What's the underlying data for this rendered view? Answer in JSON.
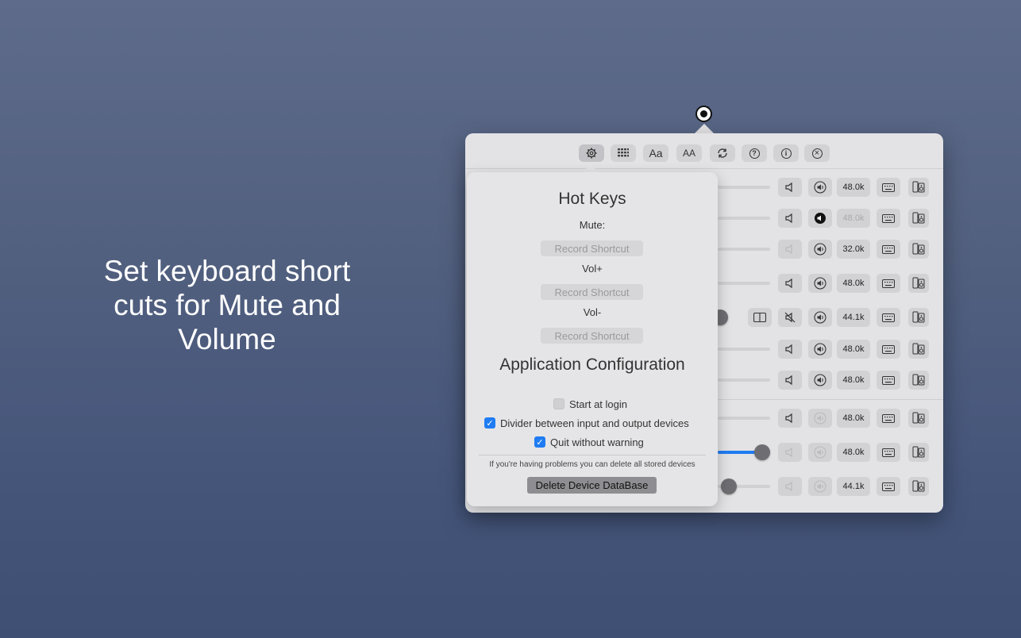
{
  "promo": {
    "text": "Set keyboard short cuts for Mute and Volume"
  },
  "menubar": {
    "icon": "record-icon"
  },
  "toolbar": {
    "buttons": [
      {
        "name": "settings",
        "icon": "gear-icon"
      },
      {
        "name": "grid",
        "icon": "grid-icon"
      },
      {
        "name": "font-small",
        "label": "Aa"
      },
      {
        "name": "font-large",
        "label": "AA"
      },
      {
        "name": "refresh",
        "icon": "refresh-icon"
      },
      {
        "name": "help",
        "label": "?"
      },
      {
        "name": "info",
        "label": "i"
      },
      {
        "name": "close",
        "label": "×"
      }
    ]
  },
  "devices": [
    {
      "rate": "48.0k",
      "rate_dim": false,
      "vol_active": false
    },
    {
      "rate": "48.0k",
      "rate_dim": true,
      "vol_active": true
    },
    {
      "rate": "32.0k",
      "rate_dim": false,
      "vol_active": false
    },
    {
      "rate": "48.0k",
      "rate_dim": false,
      "vol_active": false
    },
    {
      "rate": "44.1k",
      "rate_dim": false,
      "vol_active": false
    },
    {
      "rate": "48.0k",
      "rate_dim": false,
      "vol_active": false
    },
    {
      "rate": "48.0k",
      "rate_dim": false,
      "vol_active": false
    },
    {
      "rate": "48.0k",
      "rate_dim": false,
      "vol_active": false
    },
    {
      "rate": "48.0k",
      "rate_dim": false,
      "vol_active": false
    },
    {
      "rate": "44.1k",
      "rate_dim": false,
      "vol_active": false
    }
  ],
  "panel": {
    "hotkeys_title": "Hot Keys",
    "mute_label": "Mute:",
    "volup_label": "Vol+",
    "voldown_label": "Vol-",
    "record_label": "Record Shortcut",
    "config_title": "Application Configuration",
    "start_login": "Start at login",
    "start_login_checked": false,
    "divider_label": "Divider between input and output devices",
    "divider_checked": true,
    "quit_label": "Quit without warning",
    "quit_checked": true,
    "note": "If you're having problems you can delete all stored devices",
    "delete_label": "Delete Device DataBase"
  },
  "colors": {
    "accent": "#1f7cf2",
    "panel": "#e5e5e7"
  }
}
